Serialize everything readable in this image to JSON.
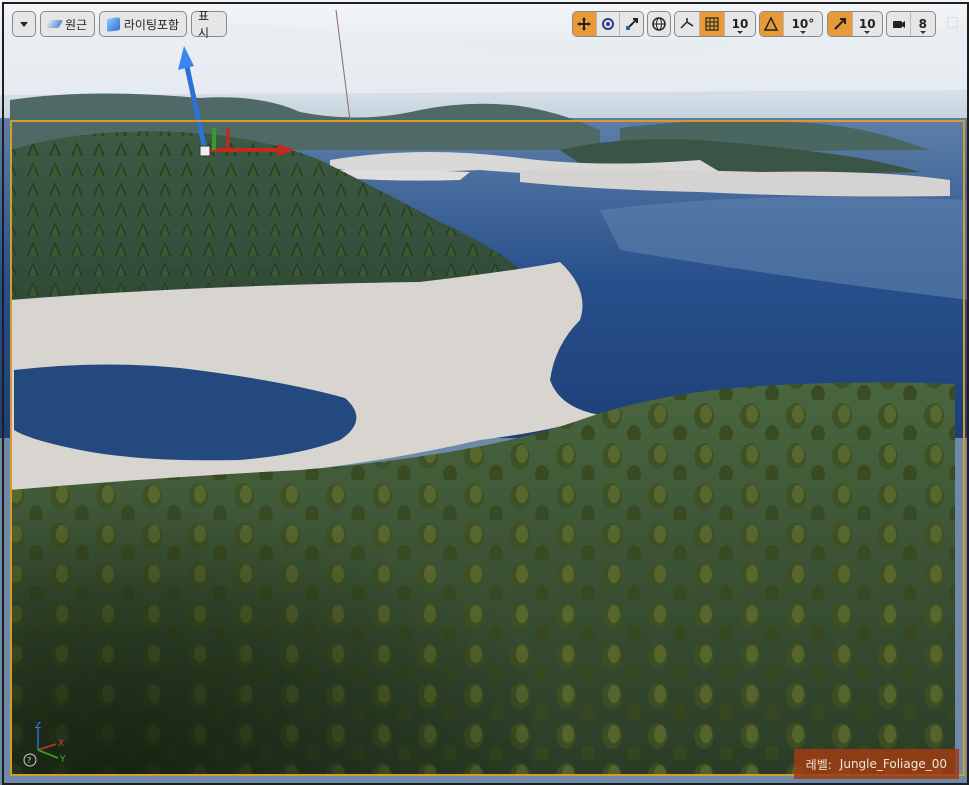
{
  "toolbar": {
    "menu_dropdown": "▾",
    "perspective_label": "원근",
    "lighting_label": "라이팅포함",
    "show_label": "표시",
    "grid_snap_value": "10",
    "rotation_snap_value": "10°",
    "scale_snap_value": "10",
    "camera_speed_value": "8"
  },
  "icons": {
    "translate": "move-arrows-icon",
    "rotate": "rotate-icon",
    "scale": "scale-icon",
    "world_local": "globe-icon",
    "surface_snap": "surface-snap-icon",
    "grid": "grid-icon",
    "rotation": "angle-icon",
    "scale_snap": "scale-arrow-icon",
    "camera": "camera-icon",
    "maximize": "maximize-icon"
  },
  "viewport": {
    "level_prefix": "레벨:",
    "level_name": "Jungle_Foliage_00"
  },
  "colors": {
    "accent_orange": "#e79a38",
    "selection_border": "#d89a2a",
    "level_badge": "#a03c14"
  }
}
